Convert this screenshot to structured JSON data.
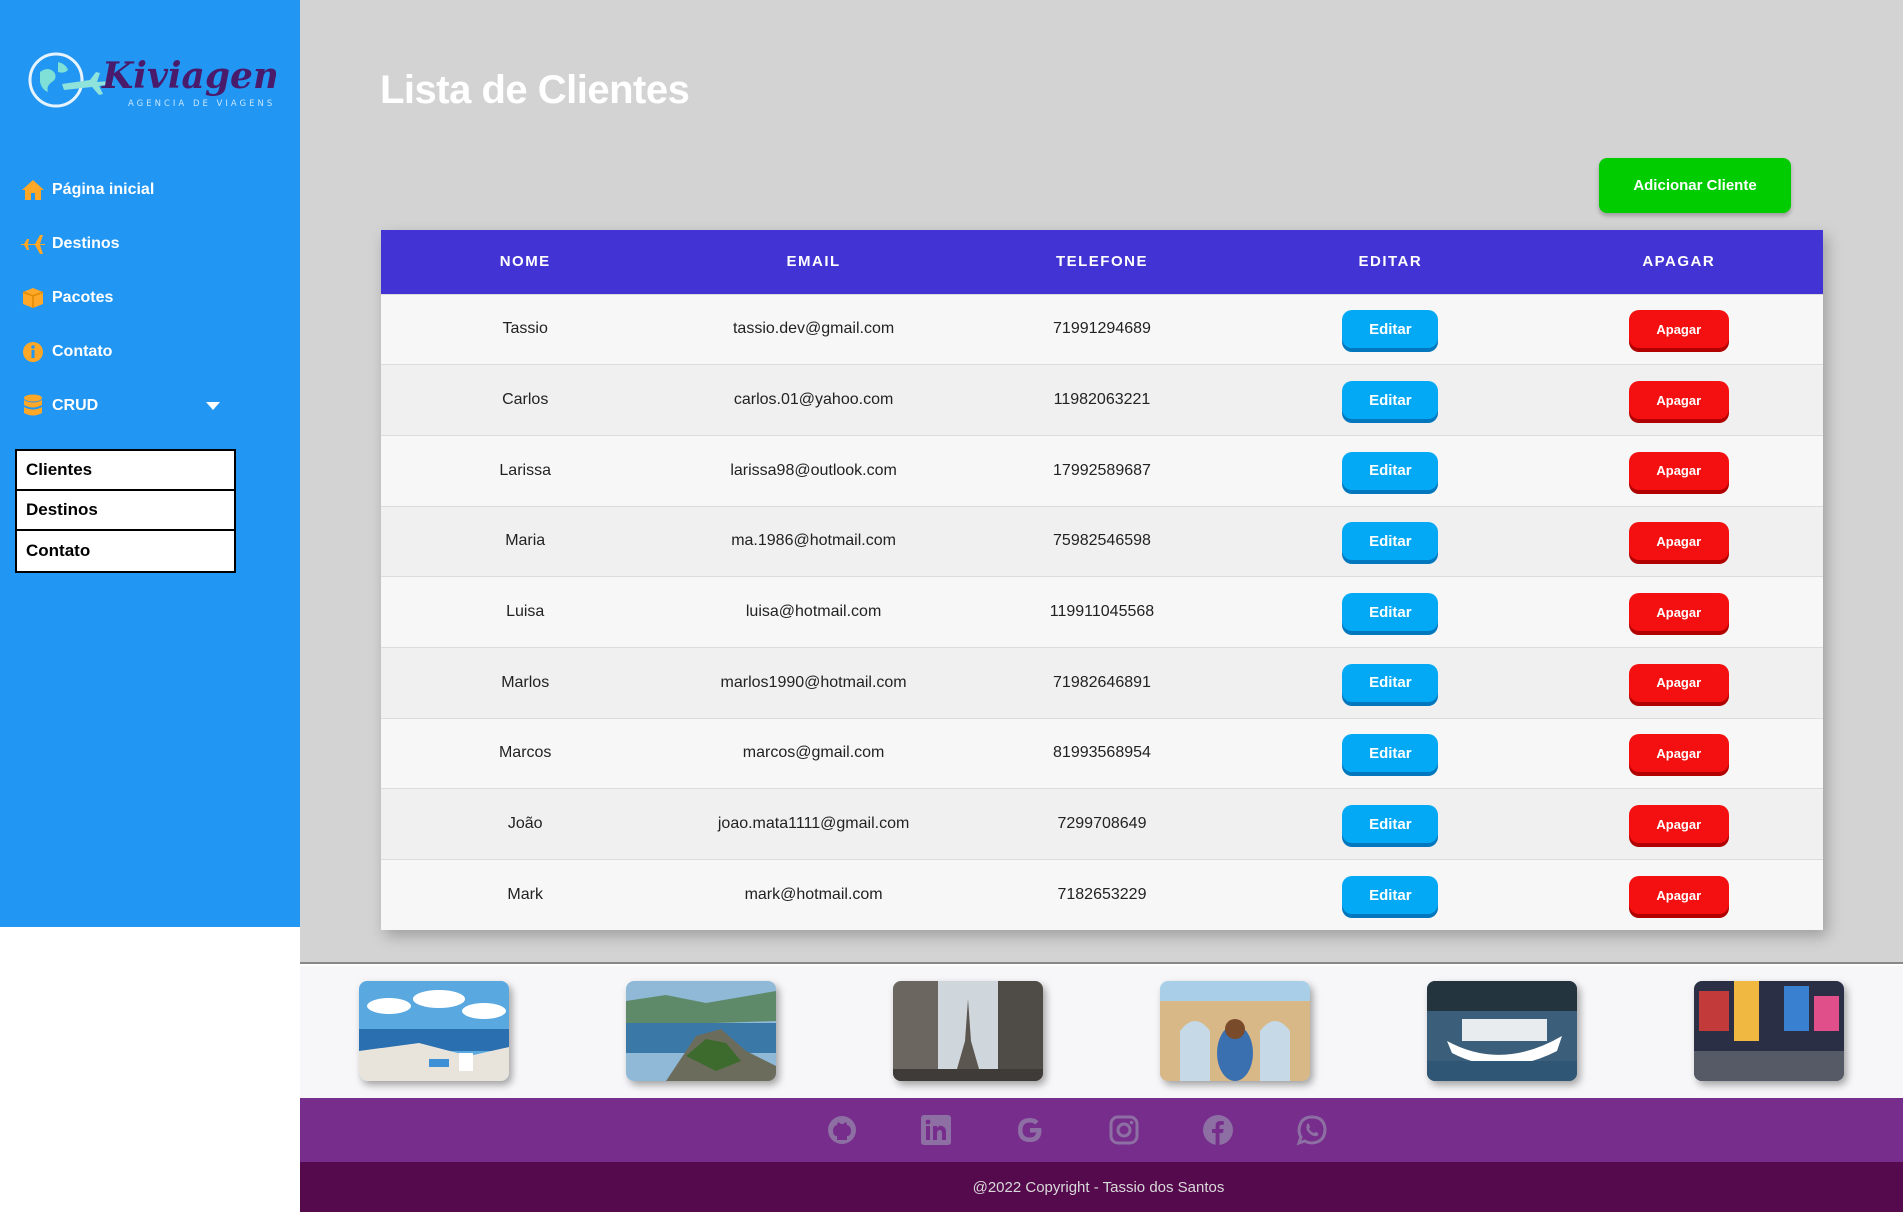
{
  "brand": {
    "name": "Kiviagem",
    "tagline": "AGENCIA DE VIAGENS"
  },
  "sidebar": {
    "items": [
      {
        "label": "Página inicial",
        "icon": "home-icon"
      },
      {
        "label": "Destinos",
        "icon": "airplane-icon"
      },
      {
        "label": "Pacotes",
        "icon": "box-icon"
      },
      {
        "label": "Contato",
        "icon": "info-icon"
      },
      {
        "label": "CRUD",
        "icon": "database-icon"
      }
    ],
    "submenu": [
      "Clientes",
      "Destinos",
      "Contato"
    ]
  },
  "page": {
    "title": "Lista de Clientes",
    "add_button": "Adicionar Cliente"
  },
  "table": {
    "headers": [
      "NOME",
      "EMAIL",
      "TELEFONE",
      "EDITAR",
      "APAGAR"
    ],
    "edit_label": "Editar",
    "delete_label": "Apagar",
    "rows": [
      {
        "name": "Tassio",
        "email": "tassio.dev@gmail.com",
        "phone": "71991294689"
      },
      {
        "name": "Carlos",
        "email": "carlos.01@yahoo.com",
        "phone": "11982063221"
      },
      {
        "name": "Larissa",
        "email": "larissa98@outlook.com",
        "phone": "17992589687"
      },
      {
        "name": "Maria",
        "email": "ma.1986@hotmail.com",
        "phone": "75982546598"
      },
      {
        "name": "Luisa",
        "email": "luisa@hotmail.com",
        "phone": "119911045568"
      },
      {
        "name": "Marlos",
        "email": "marlos1990@hotmail.com",
        "phone": "71982646891"
      },
      {
        "name": "Marcos",
        "email": "marcos@gmail.com",
        "phone": "81993568954"
      },
      {
        "name": "João",
        "email": "joao.mata1111@gmail.com",
        "phone": "7299708649"
      },
      {
        "name": "Mark",
        "email": "mark@hotmail.com",
        "phone": "7182653229"
      }
    ]
  },
  "gallery": [
    "santorini-photo",
    "coast-photo",
    "paris-photo",
    "jerusalem-photo",
    "boat-photo",
    "times-square-photo"
  ],
  "social": [
    "github-icon",
    "linkedin-icon",
    "google-icon",
    "instagram-icon",
    "facebook-icon",
    "whatsapp-icon"
  ],
  "footer": {
    "copyright": "@2022 Copyright - Tassio dos Santos"
  },
  "colors": {
    "sidebar": "#2196f3",
    "header": "#4233d4",
    "add": "#00cc00",
    "edit": "#03a9f4",
    "delete": "#f41010",
    "social_bar": "#762d8c",
    "copyright_bar": "#560a4e"
  }
}
